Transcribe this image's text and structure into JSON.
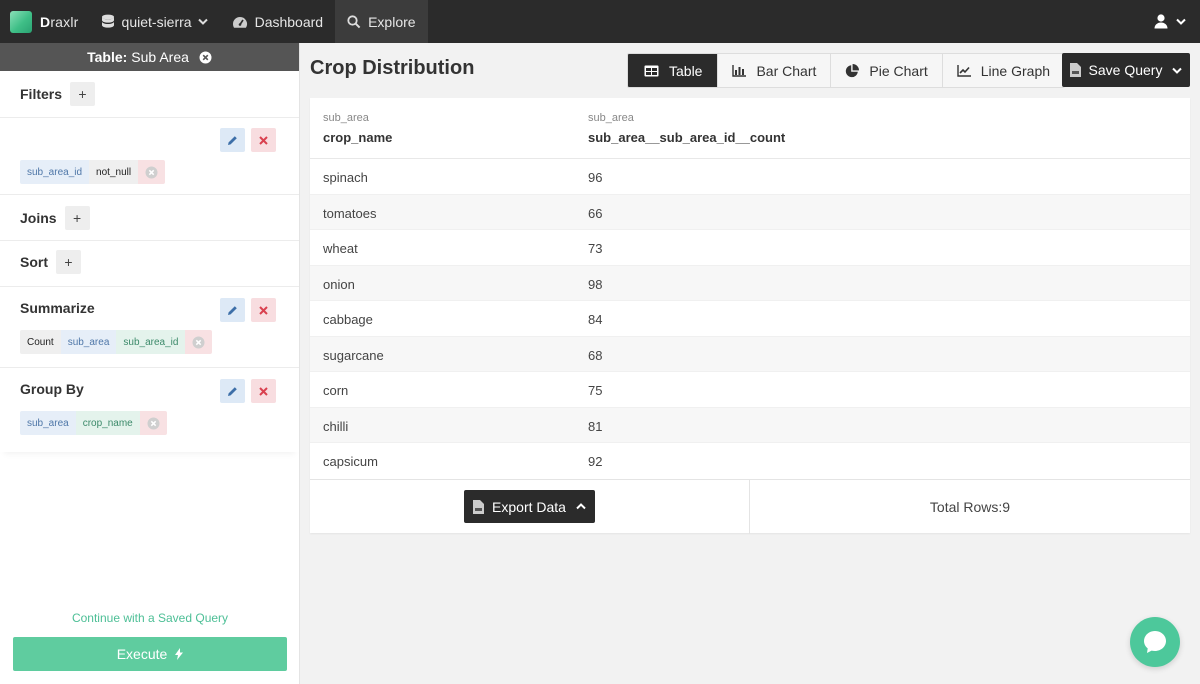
{
  "nav": {
    "brand_first": "D",
    "brand_rest": "raxlr",
    "db_name": "quiet-sierra",
    "dashboard_label": "Dashboard",
    "explore_label": "Explore"
  },
  "sidebar": {
    "table_prefix": "Table:",
    "table_name": "Sub Area",
    "filters": {
      "title": "Filters",
      "plus": "+",
      "chips": [
        "sub_area_id",
        "not_null"
      ]
    },
    "joins": {
      "title": "Joins",
      "plus": "+"
    },
    "sort": {
      "title": "Sort",
      "plus": "+"
    },
    "summarize": {
      "title": "Summarize",
      "chips": [
        "Count",
        "sub_area",
        "sub_area_id"
      ]
    },
    "group_by": {
      "title": "Group By",
      "chips": [
        "sub_area",
        "crop_name"
      ]
    },
    "continue_label": "Continue with a Saved Query",
    "execute_label": "Execute"
  },
  "main": {
    "title": "Crop Distribution",
    "views": [
      "Table",
      "Bar Chart",
      "Pie Chart",
      "Line Graph"
    ],
    "save_label": "Save Query",
    "columns": [
      {
        "table": "sub_area",
        "name": "crop_name"
      },
      {
        "table": "sub_area",
        "name": "sub_area__sub_area_id__count"
      }
    ],
    "rows": [
      [
        "spinach",
        "96"
      ],
      [
        "tomatoes",
        "66"
      ],
      [
        "wheat",
        "73"
      ],
      [
        "onion",
        "98"
      ],
      [
        "cabbage",
        "84"
      ],
      [
        "sugarcane",
        "68"
      ],
      [
        "corn",
        "75"
      ],
      [
        "chilli",
        "81"
      ],
      [
        "capsicum",
        "92"
      ]
    ],
    "export_label": "Export Data",
    "total_rows": "Total Rows:9"
  },
  "colors": {
    "nav_bg": "#2b2b2b",
    "accent_green": "#5fcc9f",
    "edit_blue": "#dde9f6",
    "delete_red": "#d9414f"
  }
}
